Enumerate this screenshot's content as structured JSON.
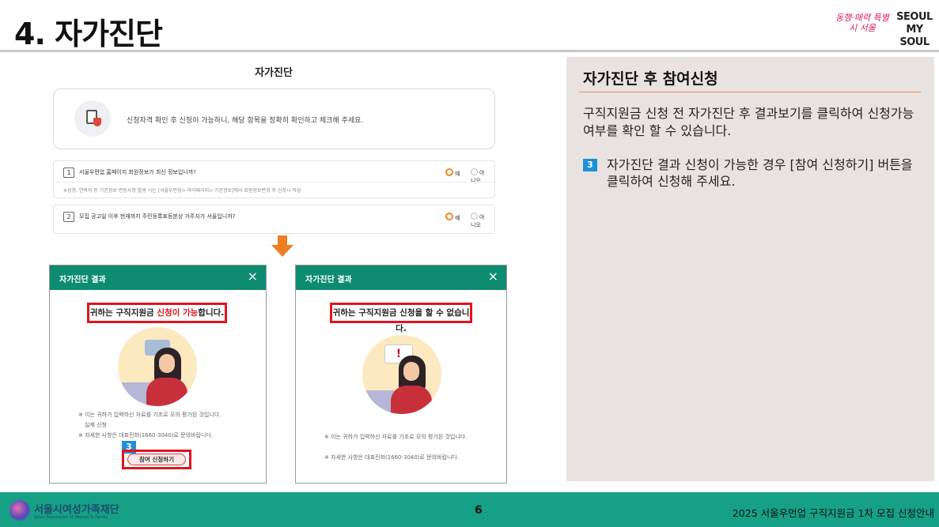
{
  "slide": {
    "title": "4. 자가진단",
    "logo_a": "동행·매력 특별시 서울",
    "logo_b": "SEOUL MY SOUL"
  },
  "screenshot": {
    "title": "자가진단",
    "info_text": "신청자격 확인 후 신청이 가능하니, 해당 항목을 정확히 확인하고 체크해 주세요.",
    "questions": [
      {
        "num": "1",
        "text": "서울우먼업 홈페이지 회원정보가 최신 정보입니까?",
        "yes": "예",
        "no": "아니오",
        "note": "※성명, 연락처 등 기본정보 변동사항 발생 시는 [서울우먼업> 마이페이지> 기본정보]에서 회원정보변경 후 신청시 작성"
      },
      {
        "num": "2",
        "text": "모집 공고일 이후 현재까지 주민등록표등본상 거주지가 서울입니까?",
        "yes": "예",
        "no": "아니오"
      }
    ]
  },
  "modal_ok": {
    "title": "자가진단 결과",
    "close": "×",
    "result_pre": "귀하는 구직지원금 ",
    "result_hl": "신청이 가능",
    "result_post": "합니다.",
    "note1": "※ 이는 귀하가 입력하신 자료를 기초로 모의 평가된 것입니다.",
    "note1b": "실제 신청",
    "note2": "※ 자세한 사항은 대표전화(1660-3040)로 문의바랍니다.",
    "badge": "3",
    "apply_button": "참여 신청하기"
  },
  "modal_fail": {
    "title": "자가진단 결과",
    "close": "×",
    "result": "귀하는 구직지원금 신청을 할 수 없습니다.",
    "warn": "!",
    "note1": "※ 이는 귀하가 입력하신 자료를 기초로 모의 평가된 것입니다.",
    "note2": "※ 자세한 사항은 대표전화(1660-3040)로 문의바랍니다."
  },
  "right_panel": {
    "heading": "자가진단 후 참여신청",
    "paragraph": "구직지원금 신청 전 자가진단 후 결과보기를 클릭하여 신청가능 여부를 확인 할 수 있습니다.",
    "step_badge": "3",
    "step_text": "자가진단 결과 신청이 가능한 경우 [참여 신청하기] 버튼을 클릭하여 신청해 주세요."
  },
  "footer": {
    "org_name": "서울시여성가족재단",
    "org_sub": "Seoul Foundation of Women & Family",
    "page_number": "6",
    "right_text": "2025 서울우먼업 구직지원금 1차 모집 신청안내"
  },
  "colors": {
    "teal": "#16a085",
    "modal_header": "#0e8c72",
    "highlight_red": "#e0141e",
    "badge_blue": "#1e90d8",
    "panel_bg": "#e8e3e0",
    "accent_orange": "#ef8a4d"
  }
}
